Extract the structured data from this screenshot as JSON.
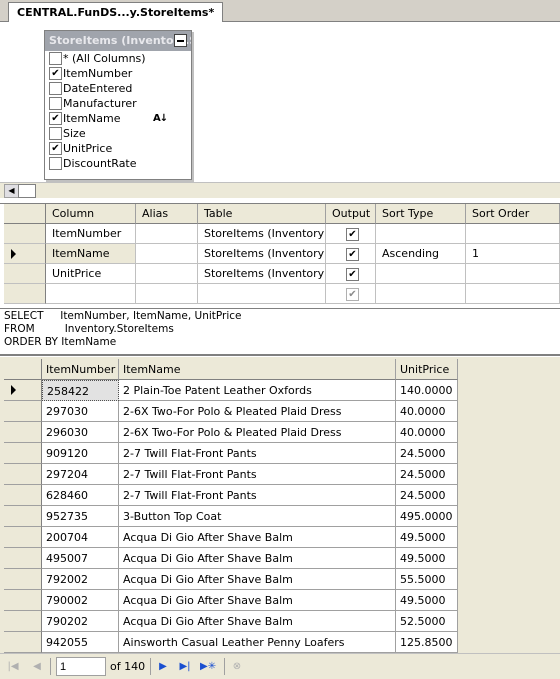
{
  "tab": {
    "title": "CENTRAL.FunDS...y.StoreItems*"
  },
  "diagram": {
    "table_title": "StoreItems (Inventory.StoreItems)",
    "columns": [
      {
        "label": "* (All Columns)",
        "checked": false
      },
      {
        "label": "ItemNumber",
        "checked": true
      },
      {
        "label": "DateEntered",
        "checked": false
      },
      {
        "label": "Manufacturer",
        "checked": false
      },
      {
        "label": "ItemName",
        "checked": true
      },
      {
        "label": "Size",
        "checked": false
      },
      {
        "label": "UnitPrice",
        "checked": true
      },
      {
        "label": "DiscountRate",
        "checked": false
      }
    ],
    "sort_icon": "A↓Z sort-ascending-icon"
  },
  "criteria": {
    "headers": [
      "Column",
      "Alias",
      "Table",
      "Output",
      "Sort Type",
      "Sort Order"
    ],
    "rows": [
      {
        "column": "ItemNumber",
        "alias": "",
        "table": "StoreItems (Inventory)",
        "output": true,
        "sort_type": "",
        "sort_order": ""
      },
      {
        "column": "ItemName",
        "alias": "",
        "table": "StoreItems (Inventory)",
        "output": true,
        "sort_type": "Ascending",
        "sort_order": "1"
      },
      {
        "column": "UnitPrice",
        "alias": "",
        "table": "StoreItems (Inventory)",
        "output": true,
        "sort_type": "",
        "sort_order": ""
      },
      {
        "column": "",
        "alias": "",
        "table": "",
        "output": true,
        "sort_type": "",
        "sort_order": ""
      }
    ]
  },
  "sql": {
    "line1": "SELECT     ItemNumber, ItemName, UnitPrice",
    "line2": "FROM         Inventory.StoreItems",
    "line3": "ORDER BY ItemName"
  },
  "results": {
    "headers": [
      "ItemNumber",
      "ItemName",
      "UnitPrice"
    ],
    "rows": [
      [
        "258422",
        "2 Plain-Toe Patent Leather Oxfords",
        "140.0000"
      ],
      [
        "297030",
        "2-6X Two-For Polo & Pleated Plaid Dress",
        "40.0000"
      ],
      [
        "296030",
        "2-6X Two-For Polo & Pleated Plaid Dress",
        "40.0000"
      ],
      [
        "909120",
        "2-7 Twill Flat-Front Pants",
        "24.5000"
      ],
      [
        "297204",
        "2-7 Twill Flat-Front Pants",
        "24.5000"
      ],
      [
        "628460",
        "2-7 Twill Flat-Front Pants",
        "24.5000"
      ],
      [
        "952735",
        "3-Button Top Coat",
        "495.0000"
      ],
      [
        "200704",
        "Acqua Di Gio After Shave Balm",
        "49.5000"
      ],
      [
        "495007",
        "Acqua Di Gio After Shave Balm",
        "49.5000"
      ],
      [
        "792002",
        "Acqua Di Gio After Shave Balm",
        "55.5000"
      ],
      [
        "790002",
        "Acqua Di Gio After Shave Balm",
        "49.5000"
      ],
      [
        "790202",
        "Acqua Di Gio After Shave Balm",
        "52.5000"
      ],
      [
        "942055",
        "Ainsworth Casual Leather Penny Loafers",
        "125.8500"
      ]
    ]
  },
  "navigator": {
    "current": "1",
    "of_label": "of 140"
  }
}
